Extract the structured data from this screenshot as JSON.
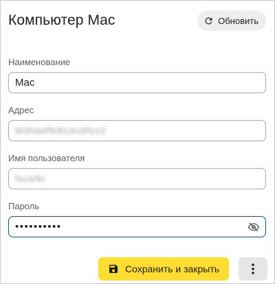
{
  "header": {
    "title": "Компьютер Mac",
    "refresh_label": "Обновить"
  },
  "fields": {
    "name": {
      "label": "Наименование",
      "value": "Mac"
    },
    "address": {
      "label": "Адрес",
      "value": "Mdhdeffk8tcks8fzs2"
    },
    "username": {
      "label": "Имя пользователя",
      "value": "fecbfkl"
    },
    "password": {
      "label": "Пароль",
      "value": "••••••••••"
    }
  },
  "actions": {
    "save_label": "Сохранить и закрыть"
  },
  "icons": {
    "refresh": "refresh-icon",
    "eye_off": "eye-off-icon",
    "save": "floppy-disk-icon",
    "more": "more-vertical-icon"
  },
  "colors": {
    "accent_button": "#ffdd33",
    "focus_border": "#1f4e79"
  }
}
